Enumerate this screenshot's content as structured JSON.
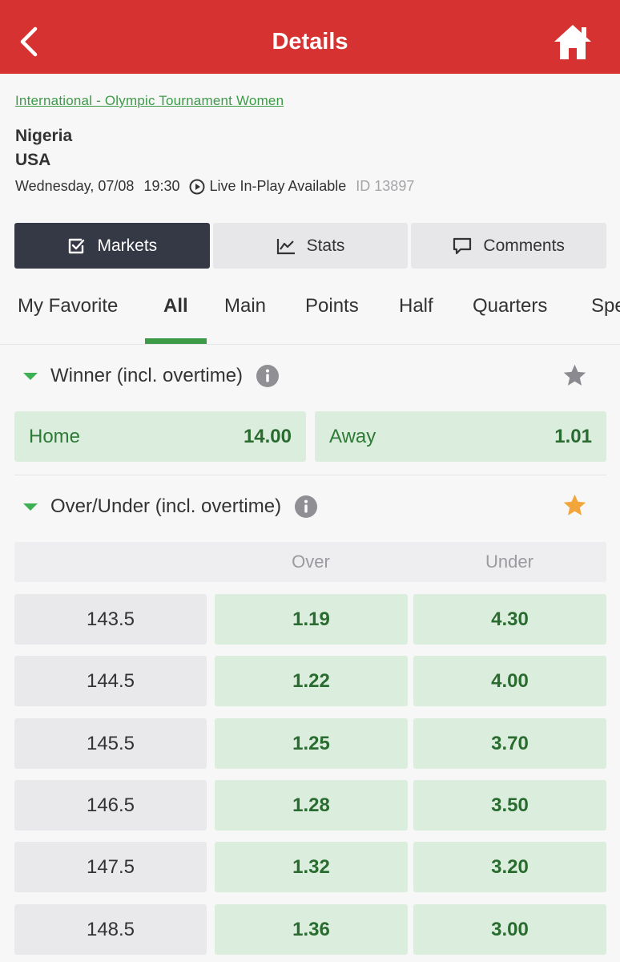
{
  "header": {
    "title": "Details"
  },
  "event": {
    "league": "International - Olympic Tournament Women",
    "home_team": "Nigeria",
    "away_team": "USA",
    "date": "Wednesday, 07/08",
    "time": "19:30",
    "live_label": "Live In-Play Available",
    "event_id": "ID 13897"
  },
  "segments": [
    {
      "label": "Markets",
      "icon": "checkbox-icon",
      "active": true
    },
    {
      "label": "Stats",
      "icon": "chart-line-icon",
      "active": false
    },
    {
      "label": "Comments",
      "icon": "comment-icon",
      "active": false
    }
  ],
  "tabs": [
    {
      "label": "My Favorite"
    },
    {
      "label": "All",
      "active": true
    },
    {
      "label": "Main"
    },
    {
      "label": "Points"
    },
    {
      "label": "Half"
    },
    {
      "label": "Quarters"
    },
    {
      "label": "Spe"
    }
  ],
  "winner_market": {
    "title": "Winner (incl. overtime)",
    "favorite": false,
    "home_label": "Home",
    "home_odds": "14.00",
    "away_label": "Away",
    "away_odds": "1.01"
  },
  "ou_market": {
    "title": "Over/Under (incl. overtime)",
    "favorite": true,
    "over_label": "Over",
    "under_label": "Under",
    "rows": [
      {
        "line": "143.5",
        "over": "1.19",
        "under": "4.30"
      },
      {
        "line": "144.5",
        "over": "1.22",
        "under": "4.00"
      },
      {
        "line": "145.5",
        "over": "1.25",
        "under": "3.70"
      },
      {
        "line": "146.5",
        "over": "1.28",
        "under": "3.50"
      },
      {
        "line": "147.5",
        "over": "1.32",
        "under": "3.20"
      },
      {
        "line": "148.5",
        "over": "1.36",
        "under": "3.00"
      }
    ]
  },
  "colors": {
    "header_red": "#d63232",
    "accent_green": "#3d9a47",
    "odds_bg": "#dbeedd",
    "active_segment": "#353945",
    "star_active": "#f2a53a",
    "star_inactive": "#8a8a90"
  }
}
